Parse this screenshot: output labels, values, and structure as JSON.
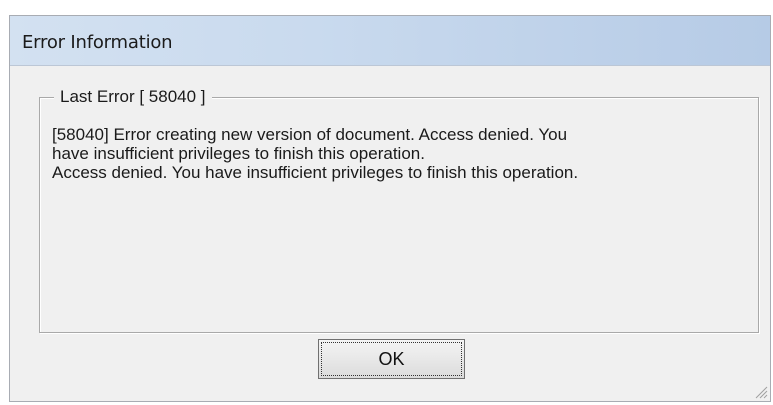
{
  "dialog": {
    "title": "Error Information",
    "group_label": "Last Error [ 58040 ]",
    "message": " [58040] Error creating new version of document. Access denied. You\nhave insufficient privileges to finish this operation.\nAccess denied. You have insufficient privileges to finish this operation.",
    "ok_label": "OK"
  },
  "colors": {
    "title_bar": "#c9daee",
    "background": "#f0f0f0"
  }
}
